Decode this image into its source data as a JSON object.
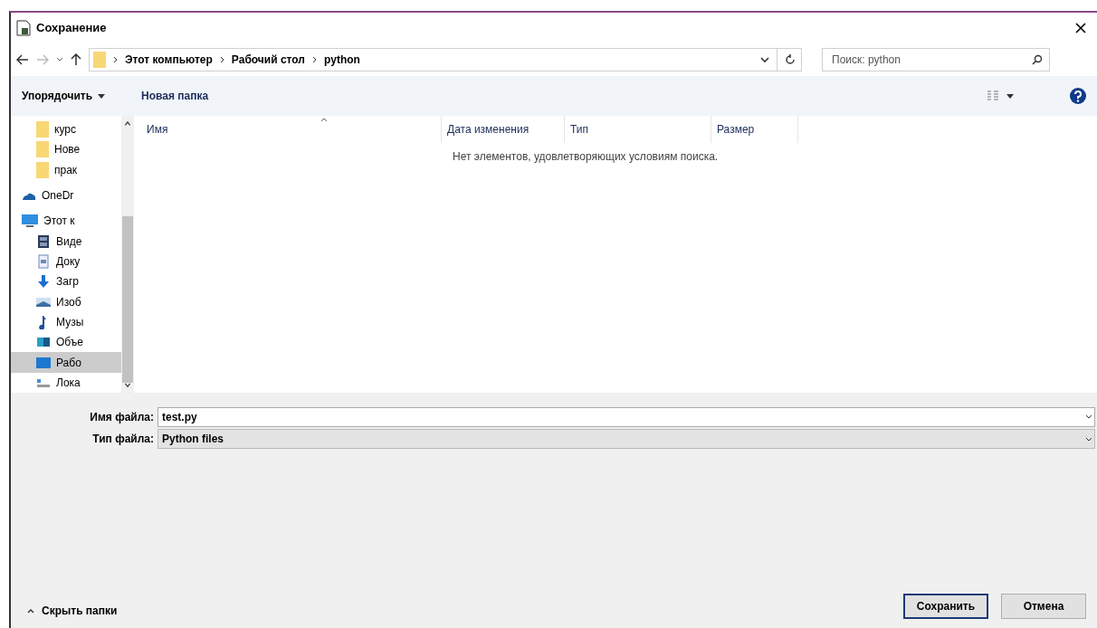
{
  "window": {
    "title": "Сохранение"
  },
  "address_bar": {
    "crumbs": [
      "Этот компьютер",
      "Рабочий стол",
      "python"
    ]
  },
  "search": {
    "placeholder": "Поиск: python"
  },
  "toolbar": {
    "organize": "Упорядочить",
    "new_folder": "Новая папка"
  },
  "sidebar": {
    "items": [
      {
        "kind": "folder",
        "label": "курс",
        "selected": false
      },
      {
        "kind": "folder",
        "label": "Нове",
        "selected": false
      },
      {
        "kind": "folder",
        "label": "прак",
        "selected": false
      },
      {
        "kind": "cloud",
        "label": "OneDr",
        "selected": false
      },
      {
        "kind": "computer",
        "label": "Этот к",
        "selected": false,
        "children": [
          {
            "kind": "video",
            "label": "Виде",
            "selected": false
          },
          {
            "kind": "document",
            "label": "Доку",
            "selected": false
          },
          {
            "kind": "download",
            "label": "Загр",
            "selected": false
          },
          {
            "kind": "image",
            "label": "Изоб",
            "selected": false
          },
          {
            "kind": "music",
            "label": "Музы",
            "selected": false
          },
          {
            "kind": "objects",
            "label": "Объе",
            "selected": false
          },
          {
            "kind": "desktop",
            "label": "Рабо",
            "selected": true
          },
          {
            "kind": "disk",
            "label": "Лока",
            "selected": false
          }
        ]
      }
    ]
  },
  "table": {
    "columns": [
      "Имя",
      "Дата изменения",
      "Тип",
      "Размер"
    ],
    "empty_message": "Нет элементов, удовлетворяющих условиям поиска."
  },
  "form": {
    "filename_label": "Имя файла:",
    "filename": "test.py",
    "type_label": "Тип файла:",
    "type": "Python files"
  },
  "hide_folders": "Скрыть папки",
  "buttons": [
    {
      "label": "Сохранить",
      "default": true
    },
    {
      "label": "Отмена",
      "default": false
    }
  ]
}
